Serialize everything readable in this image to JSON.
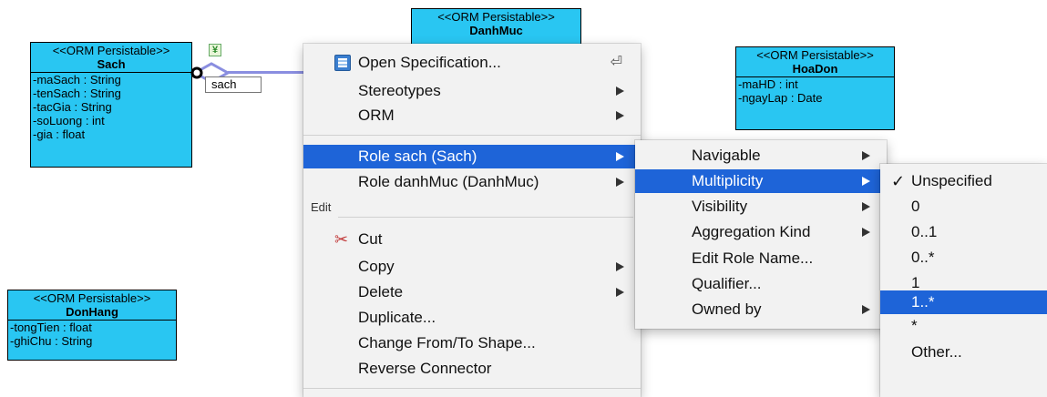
{
  "diagram": {
    "classes": [
      {
        "stereotype": "<<ORM Persistable>>",
        "name": "Sach",
        "attributes": [
          "-maSach : String",
          "-tenSach : String",
          "-tacGia : String",
          "-soLuong : int",
          "-gia : float"
        ]
      },
      {
        "stereotype": "<<ORM Persistable>>",
        "name": "DanhMuc",
        "attributes": []
      },
      {
        "stereotype": "<<ORM Persistable>>",
        "name": "HoaDon",
        "attributes": [
          "-maHD : int",
          "-ngayLap : Date"
        ]
      },
      {
        "stereotype": "<<ORM Persistable>>",
        "name": "DonHang",
        "attributes": [
          "-tongTien : float",
          "-ghiChu : String"
        ]
      }
    ],
    "role_label": "sach"
  },
  "context_menu": {
    "items": [
      {
        "label": "Open Specification...",
        "icon": "spec-icon",
        "shortcut_icon": "enter-icon"
      },
      {
        "label": "Stereotypes",
        "submenu": true
      },
      {
        "label": "ORM",
        "submenu": true
      },
      {
        "label": "Role sach (Sach)",
        "submenu": true,
        "highlighted": true
      },
      {
        "label": "Role danhMuc (DanhMuc)",
        "submenu": true
      }
    ],
    "edit_section": "Edit",
    "edit_items": [
      {
        "label": "Cut",
        "icon": "scissors-icon"
      },
      {
        "label": "Copy",
        "submenu": true
      },
      {
        "label": "Delete",
        "submenu": true
      },
      {
        "label": "Duplicate..."
      },
      {
        "label": "Change From/To Shape..."
      },
      {
        "label": "Reverse Connector"
      }
    ]
  },
  "role_submenu": {
    "items": [
      {
        "label": "Navigable",
        "submenu": true
      },
      {
        "label": "Multiplicity",
        "submenu": true,
        "highlighted": true
      },
      {
        "label": "Visibility",
        "submenu": true
      },
      {
        "label": "Aggregation Kind",
        "submenu": true
      },
      {
        "label": "Edit Role Name..."
      },
      {
        "label": "Qualifier..."
      },
      {
        "label": "Owned by",
        "submenu": true
      }
    ]
  },
  "multiplicity_submenu": {
    "checkmark": "✓",
    "items": [
      {
        "label": "Unspecified",
        "checked": true
      },
      {
        "label": "0"
      },
      {
        "label": "0..1"
      },
      {
        "label": "0..*"
      },
      {
        "label": "1"
      },
      {
        "label": "1..*",
        "highlighted": true
      },
      {
        "label": "*"
      },
      {
        "label": "Other..."
      }
    ]
  },
  "colors": {
    "class_fill": "#29c6f2",
    "highlight": "#1e64d8",
    "connector": "#8a8ee0"
  }
}
